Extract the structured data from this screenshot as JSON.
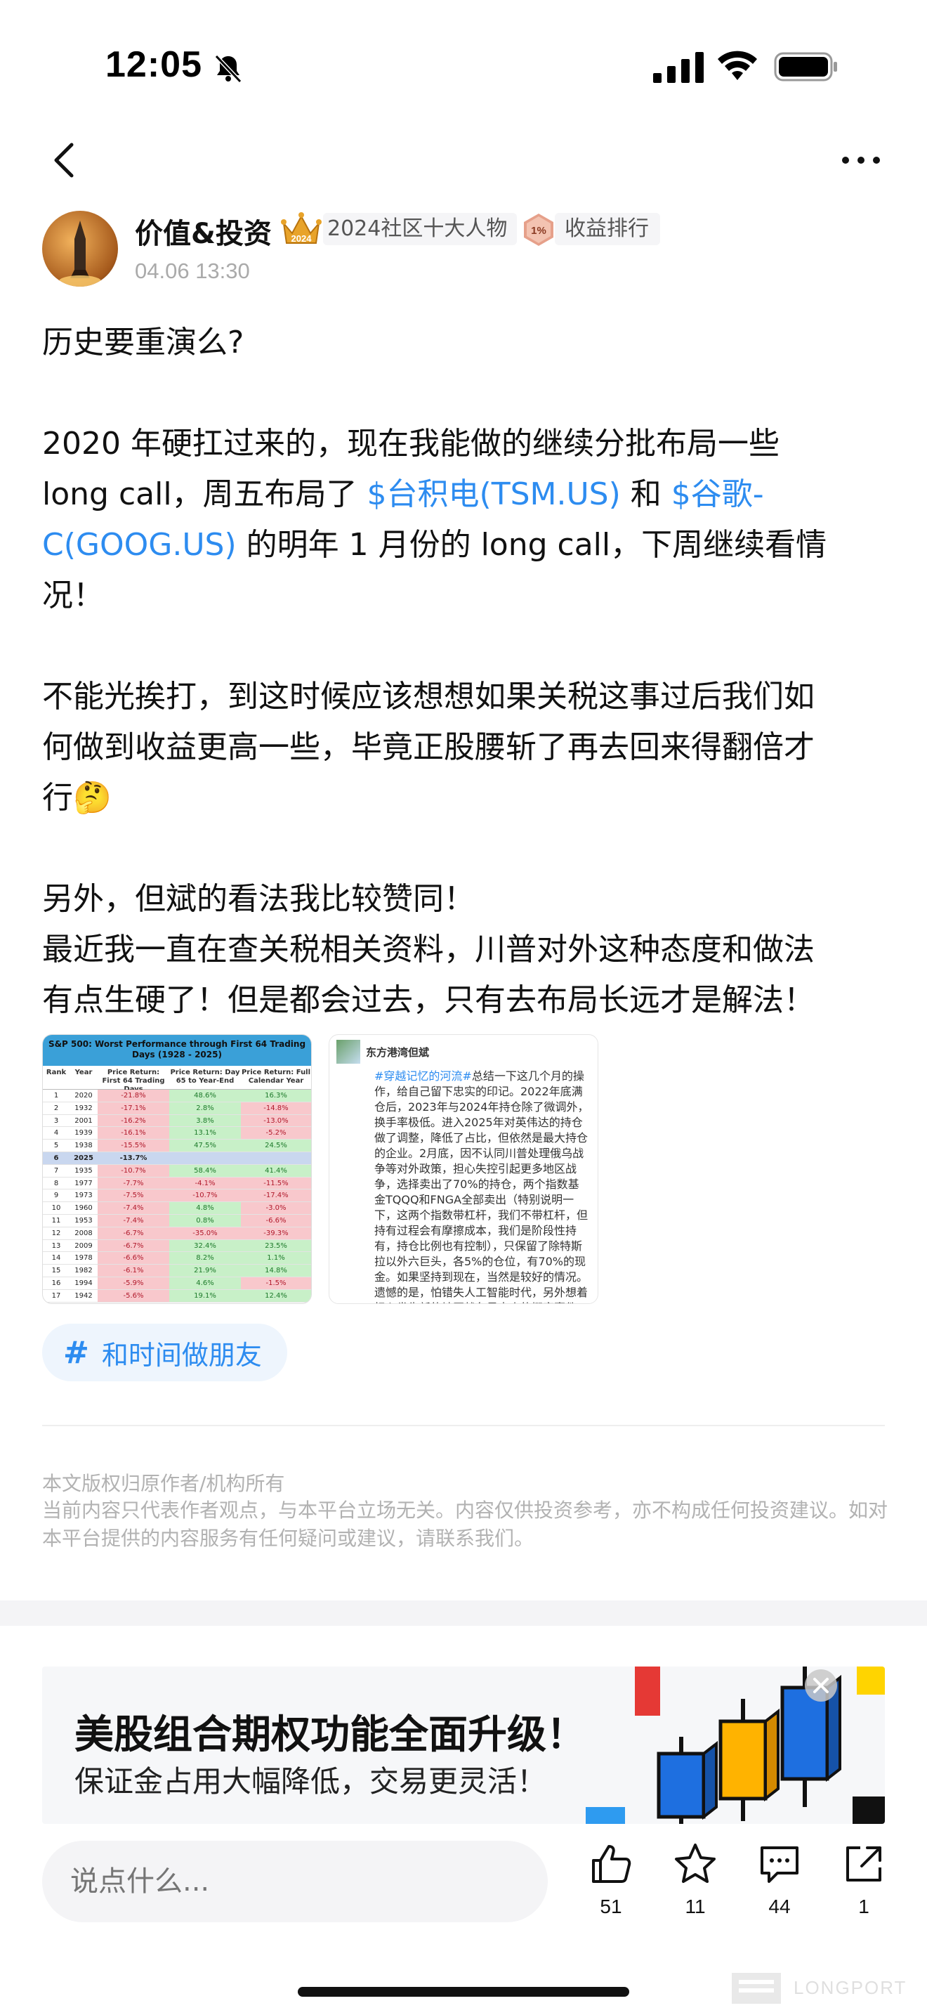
{
  "status_bar": {
    "time": "12:05"
  },
  "author": {
    "name": "价值&投资",
    "award_badge": "2024社区十大人物",
    "rank_badge": "收益排行",
    "rank_icon_text": "1%",
    "crown_year": "2024",
    "post_time": "04.06 13:30"
  },
  "post": {
    "paragraphs": [
      [
        {
          "text": "历史要重演么?"
        }
      ],
      [],
      [
        {
          "text": "2020 年硬扛过来的，现在我能做的继续分批布局一些"
        }
      ],
      [
        {
          "text": "long call，周五布局了 "
        },
        {
          "text": "$台积电(TSM.US)",
          "link": true
        },
        {
          "text": " 和 "
        },
        {
          "text": "$谷歌-",
          "link": true
        }
      ],
      [
        {
          "text": "C(GOOG.US)",
          "link": true
        },
        {
          "text": " 的明年 1 月份的 long call，下周继续看情"
        }
      ],
      [
        {
          "text": "况！"
        }
      ],
      [],
      [
        {
          "text": "不能光挨打，到这时候应该想想如果关税这事过后我们如"
        }
      ],
      [
        {
          "text": "何做到收益更高一些，毕竟正股腰斩了再去回来得翻倍才"
        }
      ],
      [
        {
          "text": "行🤔"
        }
      ],
      [],
      [
        {
          "text": "另外，但斌的看法我比较赞同！"
        }
      ],
      [
        {
          "text": "最近我一直在查关税相关资料，川普对外这种态度和做法"
        }
      ],
      [
        {
          "text": "有点生硬了！但是都会过去，只有去布局长远才是解法！"
        }
      ]
    ]
  },
  "image_table": {
    "title": "S&P 500: Worst Performance through First 64 Trading Days (1928 - 2025)",
    "headers": [
      "Rank",
      "Year",
      "Price Return: First 64 Trading Days",
      "Price Return: Day 65 to Year-End",
      "Price Return: Full Calendar Year"
    ],
    "rows": [
      [
        "1",
        "2020",
        "-21.8%",
        "48.6%",
        "16.3%"
      ],
      [
        "2",
        "1932",
        "-17.1%",
        "2.8%",
        "-14.8%"
      ],
      [
        "3",
        "2001",
        "-16.2%",
        "3.8%",
        "-13.0%"
      ],
      [
        "4",
        "1939",
        "-16.1%",
        "13.1%",
        "-5.2%"
      ],
      [
        "5",
        "1938",
        "-15.5%",
        "47.5%",
        "24.5%"
      ],
      [
        "6",
        "2025",
        "-13.7%",
        "",
        ""
      ],
      [
        "7",
        "1935",
        "-10.7%",
        "58.4%",
        "41.4%"
      ],
      [
        "8",
        "1977",
        "-7.7%",
        "-4.1%",
        "-11.5%"
      ],
      [
        "9",
        "1973",
        "-7.5%",
        "-10.7%",
        "-17.4%"
      ],
      [
        "10",
        "1960",
        "-7.4%",
        "4.8%",
        "-3.0%"
      ],
      [
        "11",
        "1953",
        "-7.4%",
        "0.8%",
        "-6.6%"
      ],
      [
        "12",
        "2008",
        "-6.7%",
        "-35.0%",
        "-39.3%"
      ],
      [
        "13",
        "2009",
        "-6.7%",
        "32.4%",
        "23.5%"
      ],
      [
        "14",
        "1978",
        "-6.6%",
        "8.2%",
        "1.1%"
      ],
      [
        "15",
        "1982",
        "-6.1%",
        "21.9%",
        "14.8%"
      ],
      [
        "16",
        "1994",
        "-5.9%",
        "4.6%",
        "-1.5%"
      ],
      [
        "17",
        "1942",
        "-5.6%",
        "19.1%",
        "12.4%"
      ]
    ],
    "colors": {
      "header": "#3aa0d8",
      "negative": "#f8c8cc",
      "positive": "#c8f0c8",
      "highlight": "#c9d7ef"
    }
  },
  "image_note": {
    "author": "东方港湾但斌",
    "tag": "#穿越记忆的河流#",
    "text": "总结一下这几个月的操作，给自己留下忠实的印记。2022年底满仓后，2023年与2024年持仓除了微调外，换手率极低。进入2025年对英伟达的持仓做了调整，降低了占比，但依然是最大持仓的企业。2月底，因不认同川普处理俄乌战争等对外政策，担心失控引起更多地区战争，选择卖出了70%的持仓，两个指数基金TQQQ和FNGA全部卖出（特别说明一下，这两个指数带杠杆，我们不带杠杆，但持有过程会有摩擦成本，我们是阶段性持有，持仓比例也有控制），只保留了除特斯拉以外六巨头，各5%的仓位，有70%的现金。如果坚持到现在，当然是较好的情况。遗憾的是，怕错失人工智能时代，另外想着担心发生新的地区战争是太小的概率事件，很快又买进去了，导致净值"
  },
  "tag": {
    "label": "和时间做朋友"
  },
  "footer": {
    "copyright": "本文版权归原作者/机构所有",
    "disclaimer": "当前内容只代表作者观点，与本平台立场无关。内容仅供投资参考，亦不构成任何投资建议。如对本平台提供的内容服务有任何疑问或建议，请联系我们。"
  },
  "ad": {
    "title": "美股组合期权功能全面升级！",
    "subtitle": "保证金占用大幅降低，交易更灵活！"
  },
  "bottom_bar": {
    "comment_placeholder": "说点什么...",
    "like_count": "51",
    "favorite_count": "11",
    "comment_count": "44",
    "share_count": "1"
  },
  "watermark": "LONGPORT",
  "colors": {
    "link": "#2d8cf0",
    "tag_bg": "#eef5fd",
    "muted": "#b2b2b2"
  }
}
